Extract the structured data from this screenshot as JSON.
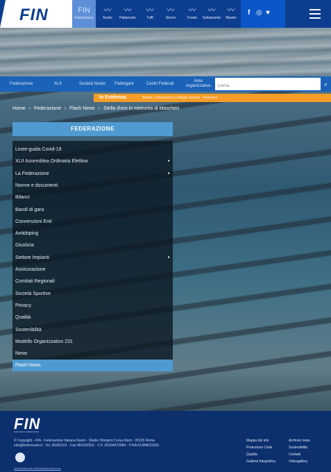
{
  "header": {
    "logo": "FIN",
    "disciplines": [
      {
        "label": "Federazione",
        "icon": "fin-icon"
      },
      {
        "label": "Nuoto",
        "icon": "swimmer-icon"
      },
      {
        "label": "Pallanuoto",
        "icon": "waterpolo-icon"
      },
      {
        "label": "Tuffi",
        "icon": "diving-icon"
      },
      {
        "label": "Sincro",
        "icon": "sincro-icon"
      },
      {
        "label": "Fondo",
        "icon": "open-water-icon"
      },
      {
        "label": "Salvamento",
        "icon": "lifesaving-icon"
      },
      {
        "label": "Master",
        "icon": "master-icon"
      }
    ],
    "social": [
      "f",
      "◎",
      "♥"
    ]
  },
  "nav": {
    "items": [
      "Federazione",
      "XLII",
      "Società Nuoto",
      "Federgare",
      "Centri Federali"
    ],
    "two_line": [
      "Area",
      "organizzativa"
    ],
    "search_placeholder": "Cerca..."
  },
  "evidence": {
    "label": "In Evidenza",
    "text": "Bando Commissione Collegio Sindaci - Mascheri"
  },
  "breadcrumb": [
    "Home",
    "›",
    "Federazione",
    "›",
    "Flash News",
    "›",
    "Stella d'oro in memoria di Mascheri"
  ],
  "sidebar": {
    "title": "FEDERAZIONE",
    "items": [
      {
        "label": "Linee-guida Covid-19",
        "arrow": ""
      },
      {
        "label": "XLII Assemblea Ordinaria Elettiva",
        "arrow": "▸"
      },
      {
        "label": "La Federazione",
        "arrow": "▸"
      },
      {
        "label": "Norme e documenti",
        "arrow": ""
      },
      {
        "label": "Bilanci",
        "arrow": ""
      },
      {
        "label": "Bandi di gara",
        "arrow": ""
      },
      {
        "label": "Convenzioni Enti",
        "arrow": ""
      },
      {
        "label": "Antidoping",
        "arrow": ""
      },
      {
        "label": "Giustizia",
        "arrow": ""
      },
      {
        "label": "Settore Impianti",
        "arrow": "▸"
      },
      {
        "label": "Assicurazione",
        "arrow": ""
      },
      {
        "label": "Comitati Regionali",
        "arrow": ""
      },
      {
        "label": "Società Sportive",
        "arrow": ""
      },
      {
        "label": "Privacy",
        "arrow": ""
      },
      {
        "label": "Qualità",
        "arrow": ""
      },
      {
        "label": "Sostenibilità",
        "arrow": ""
      },
      {
        "label": "Modello Organizzativo 231",
        "arrow": ""
      },
      {
        "label": "News",
        "arrow": ""
      },
      {
        "label": "Flash News",
        "arrow": ""
      }
    ]
  },
  "footer": {
    "logo": "FIN",
    "sub": "Federazione Italiana Nuoto",
    "copyright": "© Copyright - FIN - Federazione Italiana Nuoto - Stadio Olimpico Curva Nord - 00135 Roma",
    "contacts": "info@federnuoto.it - Tel. 06362101 - Fax 063242501 - C.F. 05294670584 - P.IVA 01384031005",
    "link": "www.federnuoto.it/federazione/privacy",
    "col1": [
      "Mappa del sito",
      "Protezione Civile",
      "Qualità",
      "Galleria fotografica"
    ],
    "col2": [
      "Archivio news",
      "Sostenibilità",
      "Contatti",
      "Videogallery"
    ]
  }
}
